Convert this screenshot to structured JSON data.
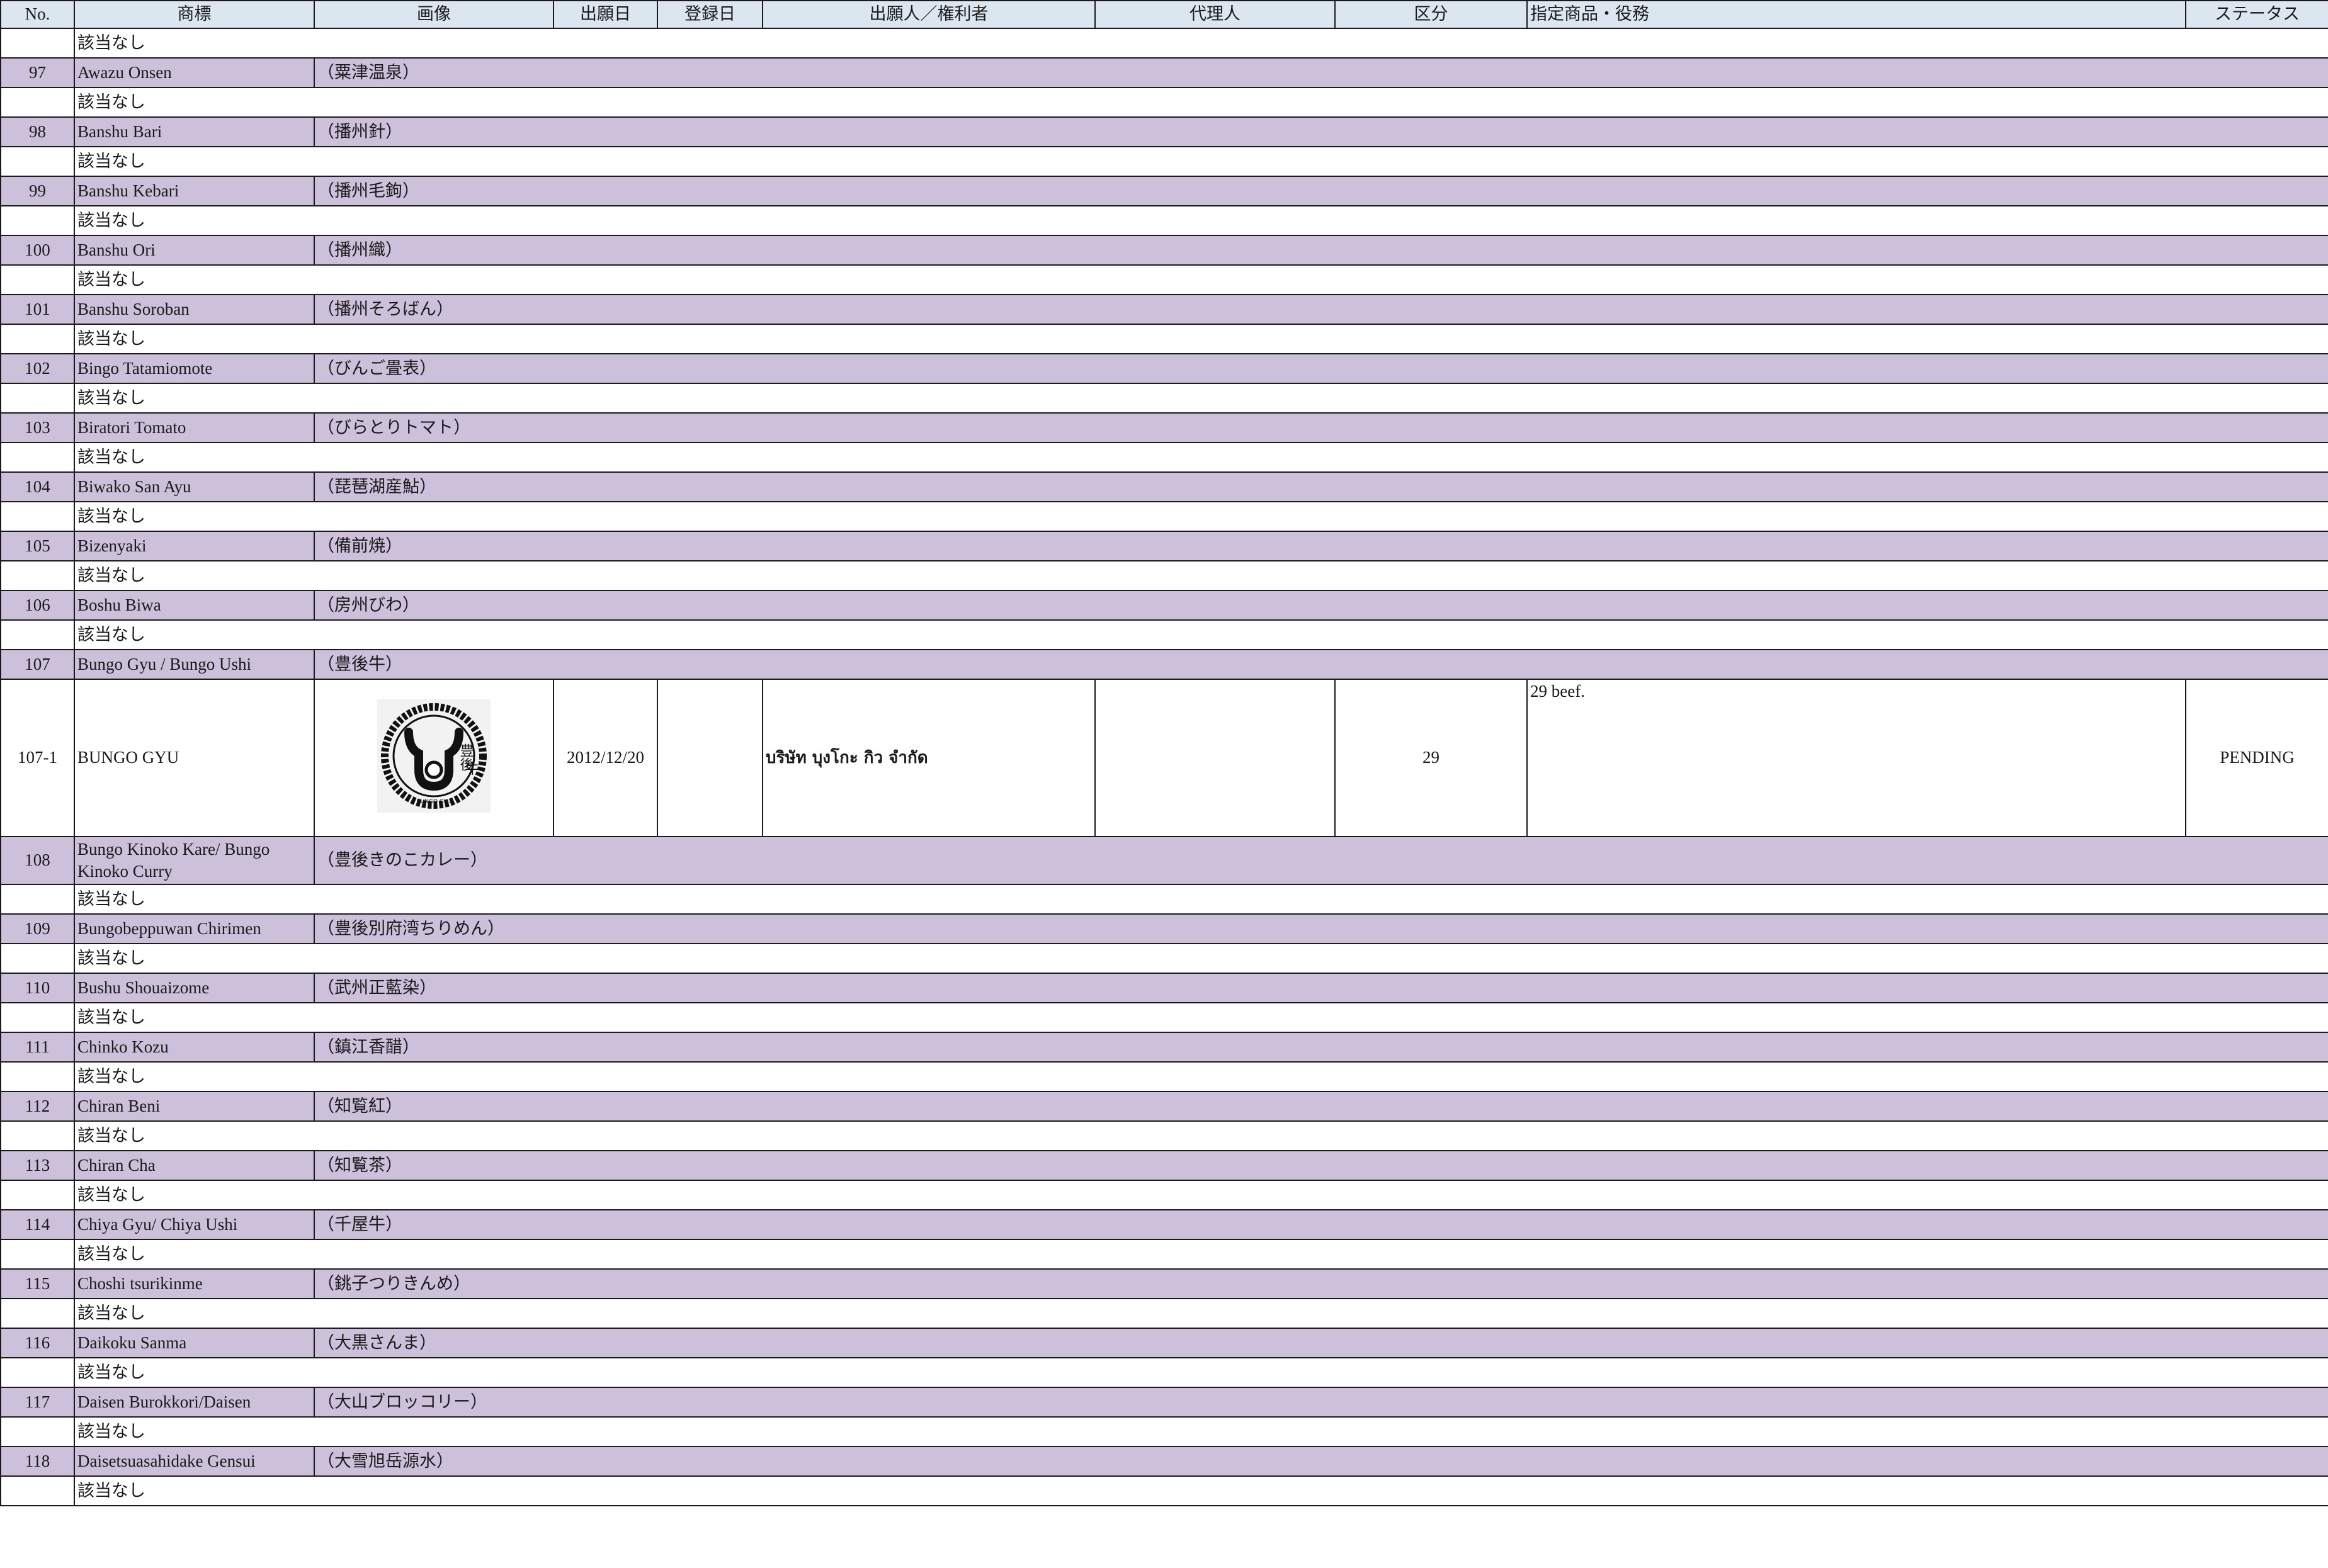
{
  "headers": {
    "no": "No.",
    "mark": "商標",
    "image": "画像",
    "filing_date": "出願日",
    "reg_date": "登録日",
    "applicant": "出願人／権利者",
    "agent": "代理人",
    "class": "区分",
    "goods": "指定商品・役務",
    "status": "ステータス"
  },
  "none_text": "該当なし",
  "gi_items": [
    {
      "no": "97",
      "mark": "Awazu Onsen",
      "jp": "（粟津温泉）"
    },
    {
      "no": "98",
      "mark": "Banshu Bari",
      "jp": "（播州針）"
    },
    {
      "no": "99",
      "mark": "Banshu Kebari",
      "jp": "（播州毛鉤）"
    },
    {
      "no": "100",
      "mark": "Banshu Ori",
      "jp": "（播州織）"
    },
    {
      "no": "101",
      "mark": "Banshu Soroban",
      "jp": "（播州そろばん）"
    },
    {
      "no": "102",
      "mark": "Bingo Tatamiomote",
      "jp": "（びんご畳表）"
    },
    {
      "no": "103",
      "mark": "Biratori Tomato",
      "jp": "（びらとりトマト）"
    },
    {
      "no": "104",
      "mark": "Biwako San Ayu",
      "jp": "（琵琶湖産鮎）"
    },
    {
      "no": "105",
      "mark": "Bizenyaki",
      "jp": "（備前焼）"
    },
    {
      "no": "106",
      "mark": "Boshu Biwa",
      "jp": "（房州びわ）"
    },
    {
      "no": "107",
      "mark": "Bungo Gyu / Bungo Ushi",
      "jp": "（豊後牛）"
    },
    {
      "no": "108",
      "mark": "Bungo Kinoko Kare/ Bungo Kinoko Curry",
      "jp": "（豊後きのこカレー）"
    },
    {
      "no": "109",
      "mark": "Bungobeppuwan Chirimen",
      "jp": "（豊後別府湾ちりめん）"
    },
    {
      "no": "110",
      "mark": "Bushu Shouaizome",
      "jp": "（武州正藍染）"
    },
    {
      "no": "111",
      "mark": "Chinko Kozu",
      "jp": "（鎮江香醋）"
    },
    {
      "no": "112",
      "mark": "Chiran Beni",
      "jp": "（知覧紅）"
    },
    {
      "no": "113",
      "mark": "Chiran Cha",
      "jp": "（知覧茶）"
    },
    {
      "no": "114",
      "mark": "Chiya Gyu/ Chiya Ushi",
      "jp": "（千屋牛）"
    },
    {
      "no": "115",
      "mark": "Choshi tsurikinme",
      "jp": "（銚子つりきんめ）"
    },
    {
      "no": "116",
      "mark": "Daikoku Sanma",
      "jp": "（大黒さんま）"
    },
    {
      "no": "117",
      "mark": "Daisen Burokkori/Daisen",
      "jp": "（大山ブロッコリー）"
    },
    {
      "no": "118",
      "mark": "Daisetsuasahidake Gensui",
      "jp": "（大雪旭岳源水）"
    }
  ],
  "application_107_1": {
    "no": "107-1",
    "mark": "BUNGO GYU",
    "logo_kanji_1": "豊後",
    "logo_kanji_2": "牛",
    "logo_caption": "BUNGO GYU",
    "filing_date": "2012/12/20",
    "reg_date": "",
    "applicant": "บริษัท บุงโกะ กิว จำกัด",
    "agent": "",
    "class": "29",
    "goods": "29 beef.",
    "status": "PENDING"
  }
}
